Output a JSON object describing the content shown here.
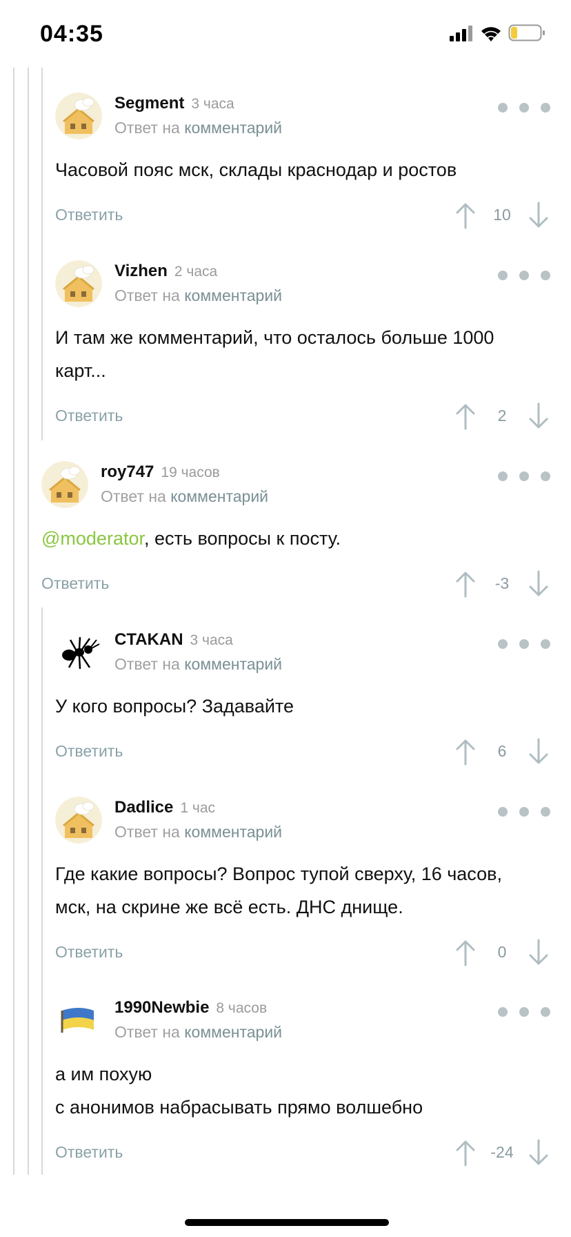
{
  "status_bar": {
    "time": "04:35"
  },
  "reply_prefix": "Ответ на",
  "reply_link": "комментарий",
  "reply_button": "Ответить",
  "comments": [
    {
      "username": "Segment",
      "time": "3 часа",
      "avatar": "chef-house",
      "lines": [
        "Часовой пояс мск, склады краснодар и ростов"
      ],
      "score": "10"
    },
    {
      "username": "Vizhen",
      "time": "2 часа",
      "avatar": "chef-house",
      "lines": [
        "И там же комментарий, что осталось больше 1000",
        "карт..."
      ],
      "score": "2"
    },
    {
      "username": "roy747",
      "time": "19 часов",
      "avatar": "chef-house",
      "mention": "@moderator",
      "lines": [
        ", есть вопросы к посту."
      ],
      "score": "-3"
    },
    {
      "username": "CTAKAN",
      "time": "3 часа",
      "avatar": "ant",
      "lines": [
        "У кого вопросы? Задавайте"
      ],
      "score": "6"
    },
    {
      "username": "Dadlice",
      "time": "1 час",
      "avatar": "chef-house",
      "lines": [
        "Где какие вопросы? Вопрос тупой сверху, 16 часов,",
        "мск, на скрине же всё есть. ДНС днище."
      ],
      "score": "0"
    },
    {
      "username": "1990Newbie",
      "time": "8 часов",
      "avatar": "flag",
      "lines": [
        "а им похую",
        "с анонимов набрасывать прямо волшебно"
      ],
      "score": "-24"
    }
  ]
}
